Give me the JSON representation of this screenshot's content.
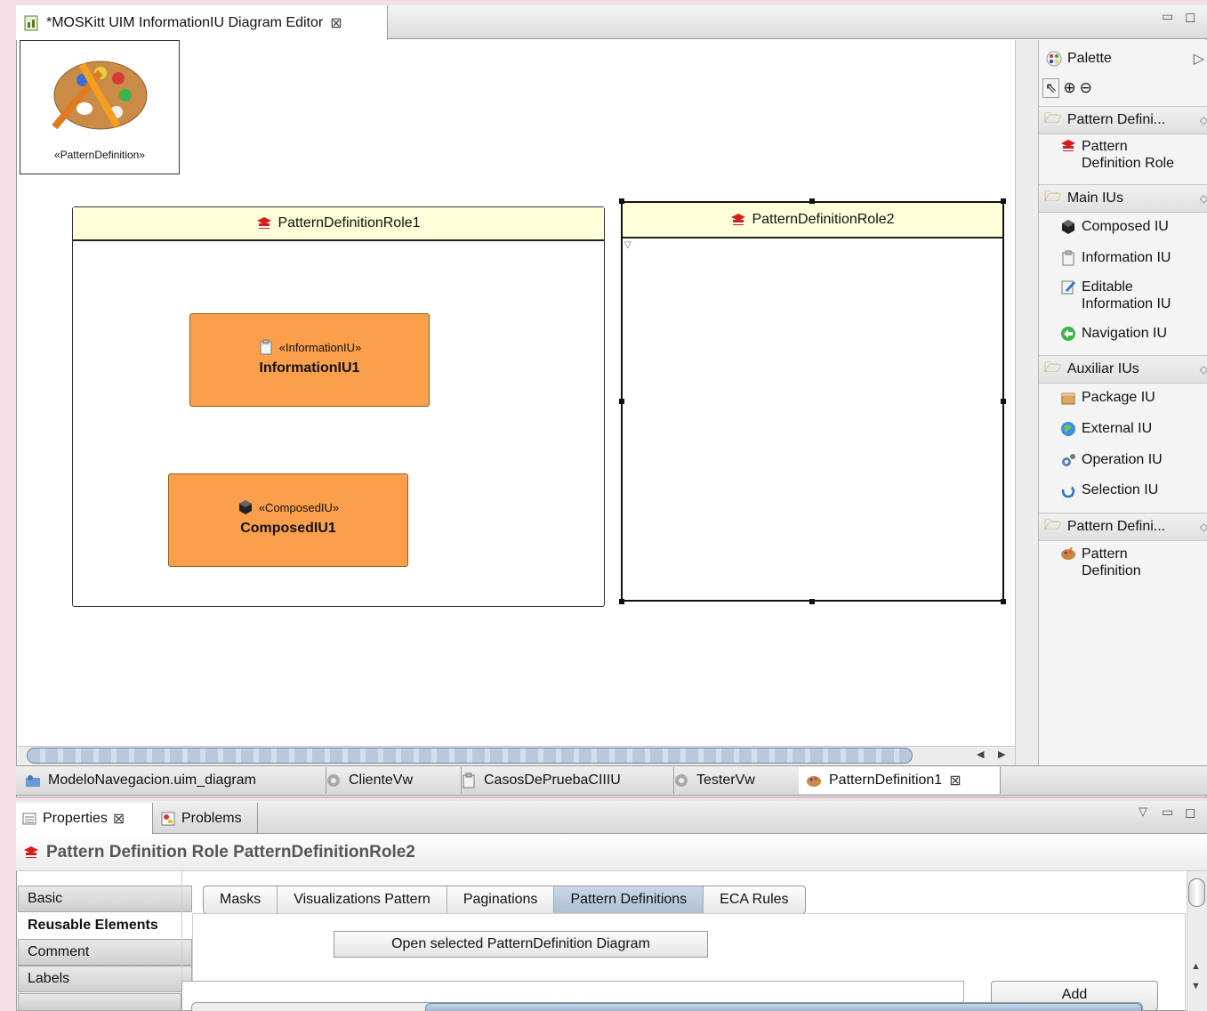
{
  "editor": {
    "tab_title": "*MOSKitt UIM InformationIU Diagram Editor",
    "window_controls": [
      "minimize",
      "maximize"
    ]
  },
  "canvas": {
    "pattern_definition_node": {
      "stereotype": "«PatternDefinition»"
    },
    "roles": [
      {
        "name": "PatternDefinitionRole1"
      },
      {
        "name": "PatternDefinitionRole2",
        "selected": true
      }
    ],
    "iu_nodes": [
      {
        "stereotype": "«InformationIU»",
        "name": "InformationIU1"
      },
      {
        "stereotype": "«ComposedIU»",
        "name": "ComposedIU1"
      }
    ]
  },
  "palette": {
    "title": "Palette",
    "drawers": [
      {
        "label": "Pattern Defini...",
        "items": [
          {
            "label_line1": "Pattern",
            "label_line2": "Definition Role",
            "icon": "role-hat-icon"
          }
        ]
      },
      {
        "label": "Main IUs",
        "items": [
          {
            "label_line1": "Composed IU",
            "icon": "cube-icon"
          },
          {
            "label_line1": "Information IU",
            "icon": "clipboard-icon"
          },
          {
            "label_line1": "Editable",
            "label_line2": "Information IU",
            "icon": "edit-icon"
          },
          {
            "label_line1": "Navigation IU",
            "icon": "navigation-icon"
          }
        ]
      },
      {
        "label": "Auxiliar IUs",
        "items": [
          {
            "label_line1": "Package IU",
            "icon": "package-icon"
          },
          {
            "label_line1": "External IU",
            "icon": "globe-icon"
          },
          {
            "label_line1": "Operation IU",
            "icon": "gears-icon"
          },
          {
            "label_line1": "Selection IU",
            "icon": "selection-icon"
          }
        ]
      },
      {
        "label": "Pattern Defini...",
        "items": [
          {
            "label_line1": "Pattern",
            "label_line2": "Definition",
            "icon": "palette-icon"
          }
        ]
      }
    ]
  },
  "editor_tabs": [
    {
      "label": "ModeloNavegacion.uim_diagram"
    },
    {
      "label": "ClienteVw"
    },
    {
      "label": "CasosDePruebaCIIIU"
    },
    {
      "label": "TesterVw"
    },
    {
      "label": "PatternDefinition1",
      "active": true
    }
  ],
  "properties": {
    "view_tabs": [
      {
        "label": "Properties"
      },
      {
        "label": "Problems"
      }
    ],
    "title": "Pattern Definition Role PatternDefinitionRole2",
    "side_tabs": [
      "Basic",
      "Reusable Elements",
      "Comment",
      "Labels"
    ],
    "active_side_tab": "Reusable Elements",
    "segments": [
      "Masks",
      "Visualizations Pattern",
      "Paginations",
      "Pattern Definitions",
      "ECA Rules"
    ],
    "active_segment": "Pattern Definitions",
    "open_button": "Open selected PatternDefinition Diagram",
    "add_button": "Add"
  }
}
